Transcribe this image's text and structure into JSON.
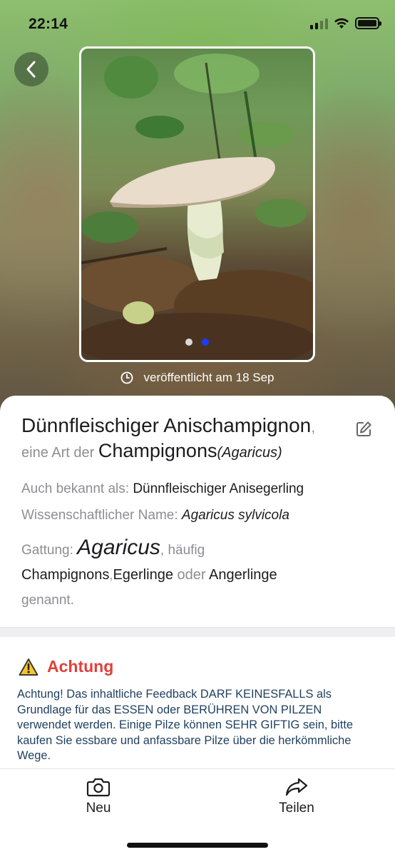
{
  "status_bar": {
    "time": "22:14",
    "signal_icon": "cellular-signal-icon",
    "wifi_icon": "wifi-icon",
    "battery_icon": "battery-icon"
  },
  "header": {
    "back_icon": "chevron-left-icon"
  },
  "photo": {
    "description_icon": "mushroom-photo",
    "dots_count": 2,
    "active_dot": 2,
    "active_color": "#1a3cff"
  },
  "published": {
    "icon": "clock-icon",
    "text": "veröffentlicht am 18 Sep"
  },
  "species": {
    "name": "Dünnfleischiger Anischampignon",
    "name_suffix": ",",
    "type_prefix": "eine Art der",
    "group": "Champignons",
    "group_latin": "(Agaricus)",
    "edit_icon": "edit-icon"
  },
  "details": {
    "aka_label": "Auch bekannt als:",
    "aka_value": "Dünnfleischiger Anisegerling",
    "sci_label": "Wissenschaftlicher Name:",
    "sci_value": "Agaricus sylvicola",
    "genus_label": "Gattung:",
    "genus_value": "Agaricus",
    "genus_suffix": ", häufig",
    "common_name_1": "Champignons",
    "common_sep_1": ",",
    "common_name_2": "Egerlinge",
    "common_sep_2": "oder",
    "common_name_3": "Angerlinge",
    "called_text": "genannt."
  },
  "warning": {
    "icon": "warning-triangle-icon",
    "title": "Achtung",
    "title_color": "#e0403a",
    "text": "Achtung! Das inhaltliche Feedback DARF KEINESFALLS als Grundlage für das ESSEN oder BERÜHREN VON PILZEN verwendet werden. Einige Pilze können SEHR GIFTIG sein, bitte kaufen Sie essbare und anfassbare Pilze über die herkömmliche Wege."
  },
  "tabbar": {
    "new_icon": "camera-icon",
    "new_label": "Neu",
    "share_icon": "share-icon",
    "share_label": "Teilen"
  }
}
